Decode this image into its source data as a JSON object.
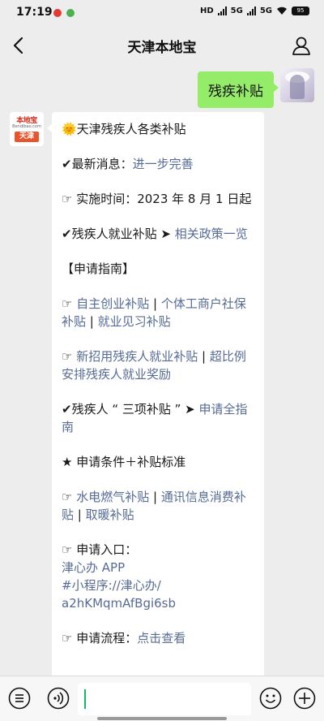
{
  "status": {
    "time": "17:19",
    "network_a": "HD",
    "network_b": "5G",
    "network_c": "5G",
    "battery": "95"
  },
  "nav": {
    "title": "天津本地宝"
  },
  "chat": {
    "sent_text": "残疾补贴",
    "bot_avatar": {
      "logo_text": "本地宝",
      "logo_sub": "Bendibao.com",
      "city": "天津"
    },
    "reply": {
      "title": "🌞天津残疾人各类补贴",
      "news_label": "✔最新消息：",
      "news_link": "进一步完善",
      "date_text": "☞ 实施时间：2023 年 8 月 1 日起",
      "employment_label": "✔残疾人就业补贴 ➤ ",
      "employment_link": "相关政策一览",
      "guide_heading": "【申请指南】",
      "guide1_prefix": "☞ ",
      "guide1_link_a": "自主创业补贴",
      "guide1_sep_a": " | ",
      "guide1_link_b": "个体工商户社保补贴",
      "guide1_sep_b": " | ",
      "guide1_link_c": "就业见习补贴",
      "guide2_prefix": "☞ ",
      "guide2_link_a": "新招用残疾人就业补贴",
      "guide2_sep": " | ",
      "guide2_link_b": "超比例安排残疾人就业奖励",
      "three_label": "✔残疾人 “ 三项补贴 ” ➤ ",
      "three_link": "申请全指南",
      "conditions": "★ 申请条件＋补贴标准",
      "util_prefix": "☞ ",
      "util_link_a": "水电燃气补贴",
      "util_sep_a": " | ",
      "util_link_b": "通讯信息消费补贴",
      "util_sep_b": " | ",
      "util_link_c": "取暖补贴",
      "entry_label": "☞ 申请入口：",
      "entry_app": "津心办 APP",
      "entry_mini_a": "#小程序://津心办/",
      "entry_mini_b": "a2hKMqmAfBgi6sb",
      "process_label": "☞ 申请流程：",
      "process_link": "点击查看"
    }
  },
  "colors": {
    "sent_bubble": "#95ec69",
    "link": "#576b95",
    "background": "#ededed",
    "cursor": "#07c160"
  }
}
